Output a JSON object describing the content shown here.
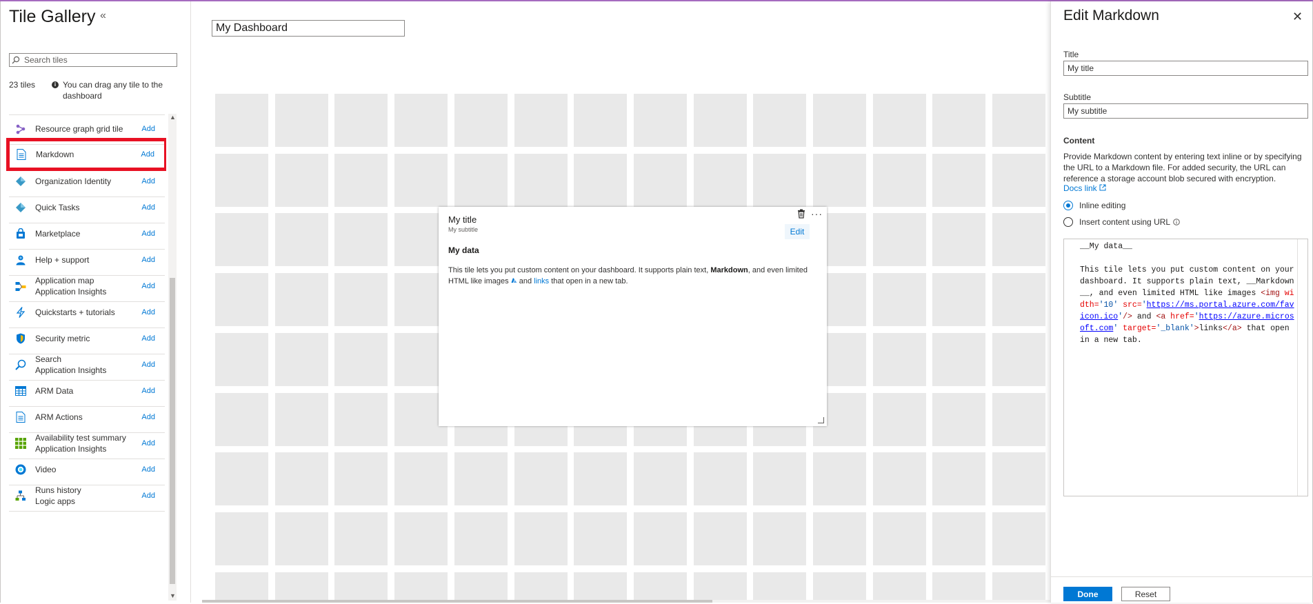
{
  "gallery": {
    "title": "Tile Gallery",
    "collapse_glyph": "«",
    "search_placeholder": "Search tiles",
    "count": "23 tiles",
    "hint": "You can drag any tile to the dashboard",
    "add_label": "Add",
    "items": [
      {
        "name": "Resource graph grid tile",
        "sub": "",
        "icon": "resource-graph-icon"
      },
      {
        "name": "Markdown",
        "sub": "",
        "icon": "document-icon",
        "selected": true
      },
      {
        "name": "Organization Identity",
        "sub": "",
        "icon": "diamond-icon"
      },
      {
        "name": "Quick Tasks",
        "sub": "",
        "icon": "diamond-icon"
      },
      {
        "name": "Marketplace",
        "sub": "",
        "icon": "shopping-bag-icon"
      },
      {
        "name": "Help + support",
        "sub": "",
        "icon": "person-icon"
      },
      {
        "name": "Application map",
        "sub": "Application Insights",
        "icon": "app-map-icon"
      },
      {
        "name": "Quickstarts + tutorials",
        "sub": "",
        "icon": "lightning-icon"
      },
      {
        "name": "Security metric",
        "sub": "",
        "icon": "shield-icon"
      },
      {
        "name": "Search",
        "sub": "Application Insights",
        "icon": "search-icon"
      },
      {
        "name": "ARM Data",
        "sub": "",
        "icon": "table-icon"
      },
      {
        "name": "ARM Actions",
        "sub": "",
        "icon": "document-icon"
      },
      {
        "name": "Availability test summary",
        "sub": "Application Insights",
        "icon": "grid-icon"
      },
      {
        "name": "Video",
        "sub": "",
        "icon": "video-icon"
      },
      {
        "name": "Runs history",
        "sub": "Logic apps",
        "icon": "runs-history-icon"
      }
    ]
  },
  "dashboard": {
    "name": "My Dashboard"
  },
  "tile": {
    "title": "My title",
    "subtitle": "My subtitle",
    "edit_label": "Edit",
    "more_glyph": "···",
    "heading": "My data",
    "body_pre": "This tile lets you put custom content on your dashboard. It supports plain text, ",
    "body_bold": "Markdown",
    "body_mid": ", and even limited HTML like images ",
    "body_and": " and ",
    "body_link": "links",
    "body_post": " that open in a new tab."
  },
  "panel": {
    "title": "Edit Markdown",
    "close_glyph": "✕",
    "title_label": "Title",
    "title_value": "My title",
    "subtitle_label": "Subtitle",
    "subtitle_value": "My subtitle",
    "content_label": "Content",
    "description": "Provide Markdown content by entering text inline or by specifying the URL to a Markdown file. For added security, the URL can reference a storage account blob secured with encryption.",
    "docs_link": "Docs link",
    "radio_inline": "Inline editing",
    "radio_url": "Insert content using URL",
    "code": {
      "line1": "__My data__",
      "p1": "This tile lets you put custom content on your dashboard. It supports plain text, __Markdown__, and even limited HTML like images ",
      "img_open": "<img",
      "attr_width": " width=",
      "val_width": "'10'",
      "attr_src": " src=",
      "q1": "'",
      "url1": "https://ms.portal.azure.com/favicon.ico",
      "q2": "'",
      "img_close": "/>",
      "and": " and ",
      "a_open": "<a",
      "attr_href": " href=",
      "q3": "'",
      "url2": "https://azure.microsoft.com",
      "q4": "'",
      "attr_target": " target=",
      "val_target": "'_blank'",
      "a_gt": ">",
      "link_text": "links",
      "a_close": "</a>",
      "tail": " that open in a new tab."
    },
    "done_label": "Done",
    "reset_label": "Reset"
  },
  "colors": {
    "accent": "#0078d4",
    "selection_border": "#e81123",
    "top_line": "#a66bbf",
    "grid_cell": "#e9e9e9"
  }
}
